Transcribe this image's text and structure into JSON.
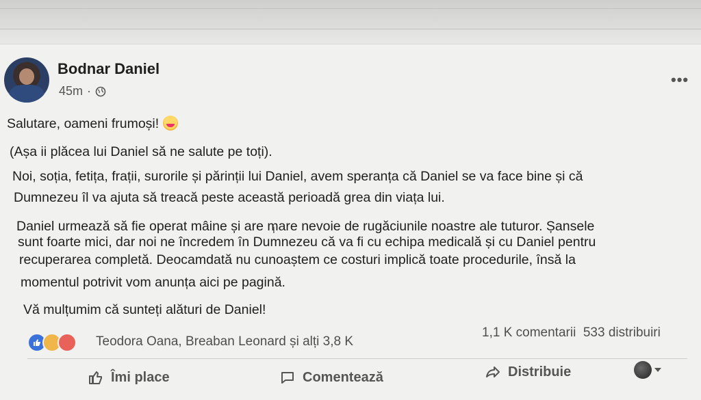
{
  "post": {
    "author": "Bodnar Daniel",
    "time": "45m",
    "separator": "·",
    "more": "•••",
    "paragraphs": [
      "Salutare, oameni frumoși!",
      "(Așa ii plăcea lui Daniel să ne salute pe toți).",
      "Noi, soția, fetița, frații, surorile și părinții lui Daniel, avem speranța că Daniel se va face bine și că",
      "Dumnezeu îl va ajuta să treacă peste această perioadă grea din viața lui.",
      "Daniel urmează să fie operat mâine și are mare nevoie de rugăciunile noastre ale tuturor. Șansele",
      "sunt foarte mici, dar noi ne încredem în Dumnezeu că va fi cu echipa medicală și cu Daniel pentru",
      "recuperarea completă. Deocamdată nu cunoaștem ce costuri implică toate procedurile, însă la",
      "momentul potrivit vom anunța aici pe pagină.",
      "Vă mulțumim că sunteți alături de Daniel!"
    ]
  },
  "reactions": {
    "names": "Teodora Oana, Breaban Leonard și alți 3,8 K",
    "comments": "1,1 K comentarii",
    "shares": "533 distribuiri",
    "icons": [
      "like-icon",
      "care-icon",
      "love-icon"
    ]
  },
  "actions": {
    "like": "Îmi place",
    "comment": "Comentează",
    "share": "Distribuie"
  }
}
